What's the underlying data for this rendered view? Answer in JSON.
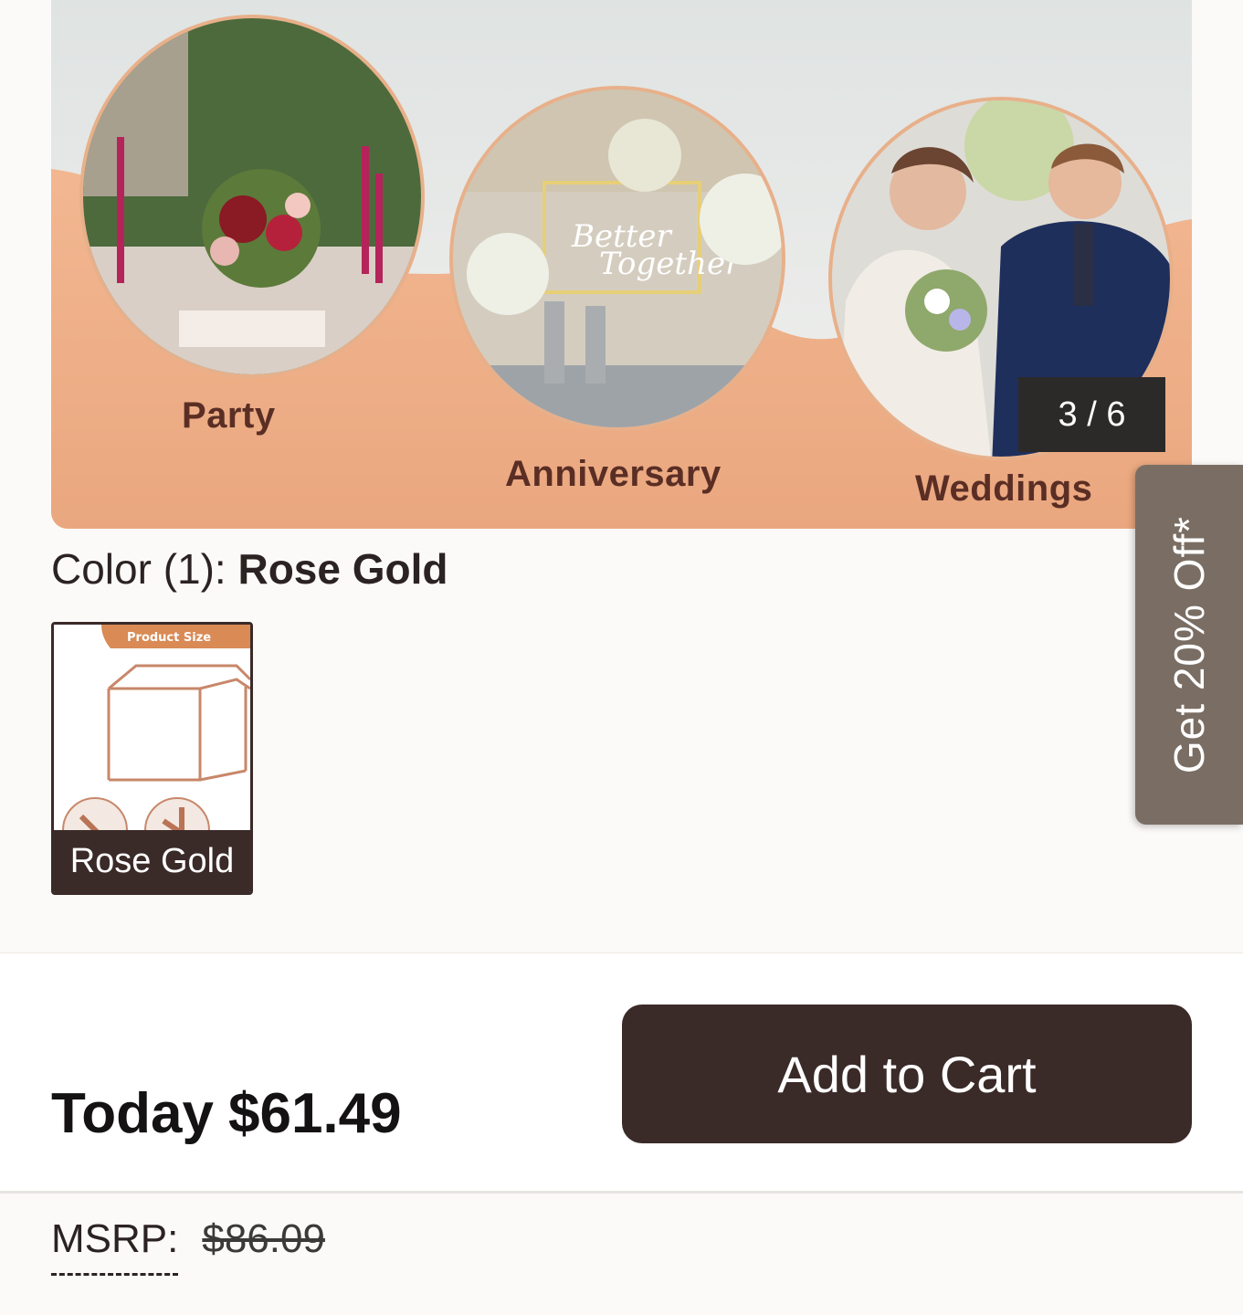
{
  "gallery": {
    "scenes": [
      {
        "label": "Party"
      },
      {
        "label": "Anniversary"
      },
      {
        "label": "Weddings"
      }
    ],
    "counter": "3 / 6",
    "accent_color": "#f0b48e"
  },
  "color_selector": {
    "label": "Color (1): ",
    "selected": "Rose Gold",
    "swatches": [
      {
        "label": "Rose Gold",
        "banner": "Product Size"
      }
    ]
  },
  "promo_tab": {
    "text": "Get 20% Off*"
  },
  "buy_bar": {
    "price_prefix": "Today",
    "price": "$61.49",
    "add_to_cart": "Add to Cart",
    "button_color": "#3a2a28"
  },
  "msrp": {
    "label": "MSRP:",
    "value": "$86.09"
  }
}
